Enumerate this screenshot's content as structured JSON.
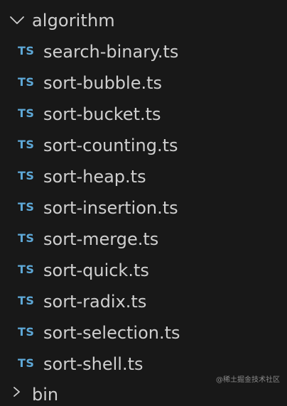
{
  "explorer": {
    "folder": {
      "label": "algorithm",
      "icon": "chevron-down-icon"
    },
    "files": [
      {
        "icon_text": "TS",
        "name": "search-binary.ts"
      },
      {
        "icon_text": "TS",
        "name": "sort-bubble.ts"
      },
      {
        "icon_text": "TS",
        "name": "sort-bucket.ts"
      },
      {
        "icon_text": "TS",
        "name": "sort-counting.ts"
      },
      {
        "icon_text": "TS",
        "name": "sort-heap.ts"
      },
      {
        "icon_text": "TS",
        "name": "sort-insertion.ts"
      },
      {
        "icon_text": "TS",
        "name": "sort-merge.ts"
      },
      {
        "icon_text": "TS",
        "name": "sort-quick.ts"
      },
      {
        "icon_text": "TS",
        "name": "sort-radix.ts"
      },
      {
        "icon_text": "TS",
        "name": "sort-selection.ts"
      },
      {
        "icon_text": "TS",
        "name": "sort-shell.ts"
      }
    ],
    "next_folder": {
      "label": "bin",
      "icon": "chevron-right-icon"
    }
  },
  "watermark": "@稀土掘金技术社区",
  "colors": {
    "background": "#181818",
    "text": "#cfcfcf",
    "ts_icon": "#5ea9d8"
  }
}
